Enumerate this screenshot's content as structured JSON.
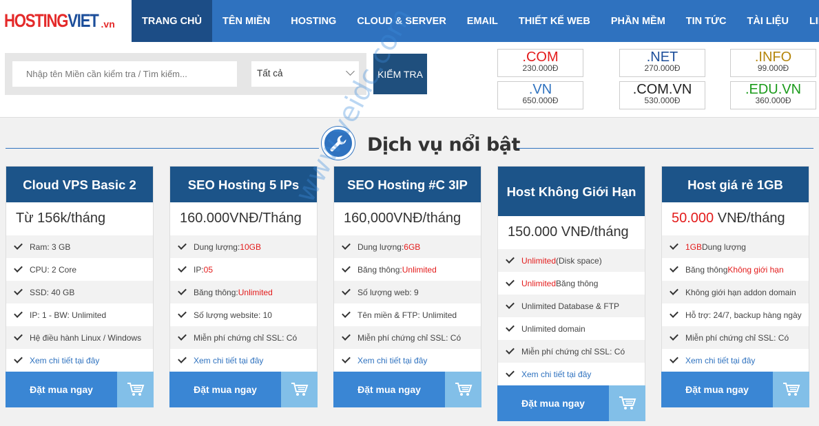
{
  "logo": {
    "main_a": "HOSTING",
    "main_b": "VIET",
    "tld": ".vn"
  },
  "nav": {
    "items": [
      "TRANG CHỦ",
      "TÊN MIỀN",
      "HOSTING",
      "CLOUD & SERVER",
      "EMAIL",
      "THIẾT KẾ WEB",
      "PHẦN MỀM",
      "TIN TỨC",
      "TÀI LIỆU",
      "LIÊN HỆ"
    ],
    "active_index": 0
  },
  "search": {
    "placeholder": "Nhập tên Miền cần kiểm tra / Tìm kiếm...",
    "select_value": "Tất cả",
    "button_label": "KIỂM TRA"
  },
  "tlds": [
    {
      "name": ".COM",
      "price": "230.000Đ",
      "color": "#e31b1b"
    },
    {
      "name": ".NET",
      "price": "270.000Đ",
      "color": "#1c4e9a"
    },
    {
      "name": ".INFO",
      "price": "99.000Đ",
      "color": "#b5860b"
    },
    {
      "name": ".VN",
      "price": "650.000Đ",
      "color": "#2f72bf"
    },
    {
      "name": ".COM.VN",
      "price": "530.000Đ",
      "color": "#222222"
    },
    {
      "name": ".EDU.VN",
      "price": "360.000Đ",
      "color": "#1a9a1a"
    }
  ],
  "section_title": "Dịch vụ nổi bật",
  "watermark": "www.veidc.com",
  "order_label": "Đặt mua ngay",
  "cards": [
    {
      "title": "Cloud VPS Basic 2",
      "price_red": "",
      "price": "Từ 156k/tháng",
      "features": [
        {
          "pre": "Ram: 3 GB",
          "hl": "",
          "post": ""
        },
        {
          "pre": "CPU: 2 Core",
          "hl": "",
          "post": ""
        },
        {
          "pre": "SSD: 40 GB",
          "hl": "",
          "post": ""
        },
        {
          "pre": "IP: 1  -  BW: Unlimited",
          "hl": "",
          "post": ""
        },
        {
          "pre": "Hệ điều hành Linux / Windows",
          "hl": "",
          "post": ""
        }
      ],
      "link": "Xem chi tiết tại đây"
    },
    {
      "title": "SEO Hosting 5 IPs",
      "price_red": "",
      "price": "160.000VNĐ/Tháng",
      "features": [
        {
          "pre": "Dung lượng: ",
          "hl": "10GB",
          "post": ""
        },
        {
          "pre": "IP: ",
          "hl": "05",
          "post": ""
        },
        {
          "pre": "Băng thông: ",
          "hl": "Unlimited",
          "post": ""
        },
        {
          "pre": "Số lượng website: 10",
          "hl": "",
          "post": ""
        },
        {
          "pre": "Miễn phí chứng chỉ SSL: Có",
          "hl": "",
          "post": ""
        }
      ],
      "link": "Xem chi tiết tại đây"
    },
    {
      "title": "SEO Hosting #C 3IP",
      "price_red": "",
      "price": "160,000VNĐ/tháng",
      "features": [
        {
          "pre": "Dung lượng: ",
          "hl": "6GB",
          "post": ""
        },
        {
          "pre": "Băng thông: ",
          "hl": "Unlimited",
          "post": ""
        },
        {
          "pre": "Số lượng web: 9",
          "hl": "",
          "post": ""
        },
        {
          "pre": "Tên miền & FTP: Unlimited",
          "hl": "",
          "post": ""
        },
        {
          "pre": "Miễn phí chứng chỉ SSL: Có",
          "hl": "",
          "post": ""
        }
      ],
      "link": "Xem chi tiết tại đây"
    },
    {
      "title": "Host Không Giới Hạn",
      "price_red": "",
      "price": "150.000 VNĐ/tháng",
      "features": [
        {
          "pre": "",
          "hl": "Unlimited",
          "post": " (Disk space)"
        },
        {
          "pre": "",
          "hl": "Unlimited",
          "post": " Băng thông"
        },
        {
          "pre": "Unlimited Database &  FTP",
          "hl": "",
          "post": ""
        },
        {
          "pre": "Unlimited domain",
          "hl": "",
          "post": ""
        },
        {
          "pre": "Miễn phí chứng chỉ SSL: Có",
          "hl": "",
          "post": ""
        }
      ],
      "link": "Xem chi tiết tại đây"
    },
    {
      "title": "Host giá rẻ 1GB",
      "price_red": "50.000",
      "price": " VNĐ/tháng",
      "features": [
        {
          "pre": "",
          "hl": "1GB",
          "post": " Dung lượng"
        },
        {
          "pre": "Băng thông ",
          "hl": "Không giới hạn",
          "post": ""
        },
        {
          "pre": "Không giới hạn addon domain",
          "hl": "",
          "post": ""
        },
        {
          "pre": "Hỗ trợ: 24/7, backup hàng ngày",
          "hl": "",
          "post": ""
        },
        {
          "pre": "Miễn phí chứng chỉ SSL: Có",
          "hl": "",
          "post": ""
        }
      ],
      "link": "Xem chi tiết tại đây"
    }
  ]
}
